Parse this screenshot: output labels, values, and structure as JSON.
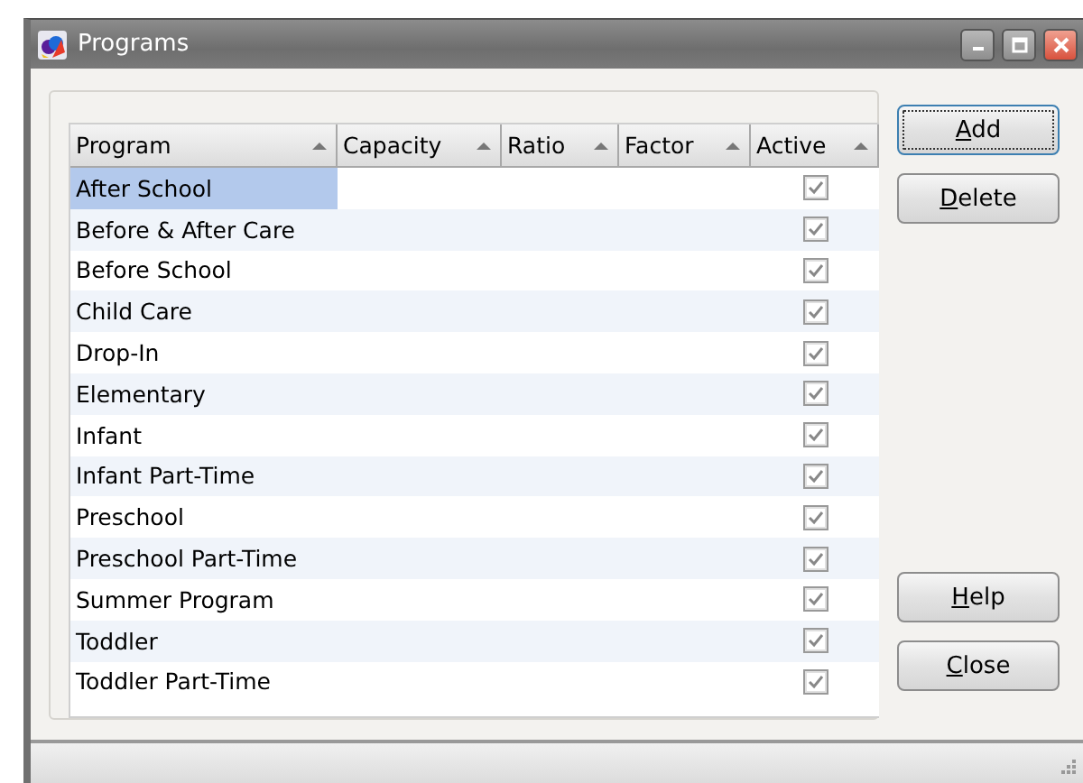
{
  "window": {
    "title": "Programs"
  },
  "table": {
    "columns": [
      {
        "label": "Program"
      },
      {
        "label": "Capacity"
      },
      {
        "label": "Ratio"
      },
      {
        "label": "Factor"
      },
      {
        "label": "Active"
      }
    ],
    "rows": [
      {
        "program": "After School",
        "active": true,
        "selected": true
      },
      {
        "program": "Before & After Care",
        "active": true,
        "selected": false
      },
      {
        "program": "Before School",
        "active": true,
        "selected": false
      },
      {
        "program": "Child Care",
        "active": true,
        "selected": false
      },
      {
        "program": "Drop-In",
        "active": true,
        "selected": false
      },
      {
        "program": "Elementary",
        "active": true,
        "selected": false
      },
      {
        "program": "Infant",
        "active": true,
        "selected": false
      },
      {
        "program": "Infant Part-Time",
        "active": true,
        "selected": false
      },
      {
        "program": "Preschool",
        "active": true,
        "selected": false
      },
      {
        "program": "Preschool Part-Time",
        "active": true,
        "selected": false
      },
      {
        "program": "Summer Program",
        "active": true,
        "selected": false
      },
      {
        "program": "Toddler",
        "active": true,
        "selected": false
      },
      {
        "program": "Toddler Part-Time",
        "active": true,
        "selected": false
      }
    ]
  },
  "top_buttons": [
    {
      "mnemonic": "A",
      "rest": "dd",
      "default": true
    },
    {
      "mnemonic": "D",
      "rest": "elete",
      "default": false
    }
  ],
  "bottom_buttons": [
    {
      "mnemonic": "H",
      "rest": "elp",
      "default": false
    },
    {
      "mnemonic": "C",
      "rest": "lose",
      "default": false
    }
  ]
}
